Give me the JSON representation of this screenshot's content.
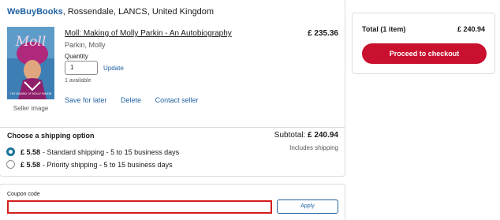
{
  "cart": {
    "seller_name": "WeBuyBooks",
    "seller_location": ", Rossendale, LANCS, United Kingdom",
    "item": {
      "title": "Moll: Making of Molly Parkin - An Autobiography",
      "price": "£ 235.36",
      "author": "Parkin, Molly",
      "quantity_label": "Quantity",
      "quantity_value": "1",
      "update_label": "Update",
      "available": "1 available",
      "cover_title": "Moll",
      "cover_caption": "THE MAKING OF MOLLY PARKIN",
      "seller_image_label": "Seller image",
      "actions": [
        "Save for later",
        "Delete",
        "Contact seller"
      ]
    },
    "shipping": {
      "title": "Choose a shipping option",
      "subtotal_label": "Subtotal: ",
      "subtotal_value": "£ 240.94",
      "includes": "Includes shipping",
      "options": [
        {
          "price": "£ 5.58",
          "label": "- Standard shipping - 5 to 15 business days",
          "selected": true
        },
        {
          "price": "£ 5.58",
          "label": "- Priority shipping - 5 to 15 business days",
          "selected": false
        }
      ]
    }
  },
  "coupon": {
    "label": "Coupon code",
    "value": "",
    "apply_label": "Apply"
  },
  "summary": {
    "total_label": "Total (1 item)",
    "total_value": "£ 240.94",
    "checkout_label": "Proceed to checkout"
  },
  "colors": {
    "link": "#2162a1",
    "checkout": "#c9102f",
    "coupon_error": "#d41e1e",
    "radio_selected": "#1a7399"
  }
}
